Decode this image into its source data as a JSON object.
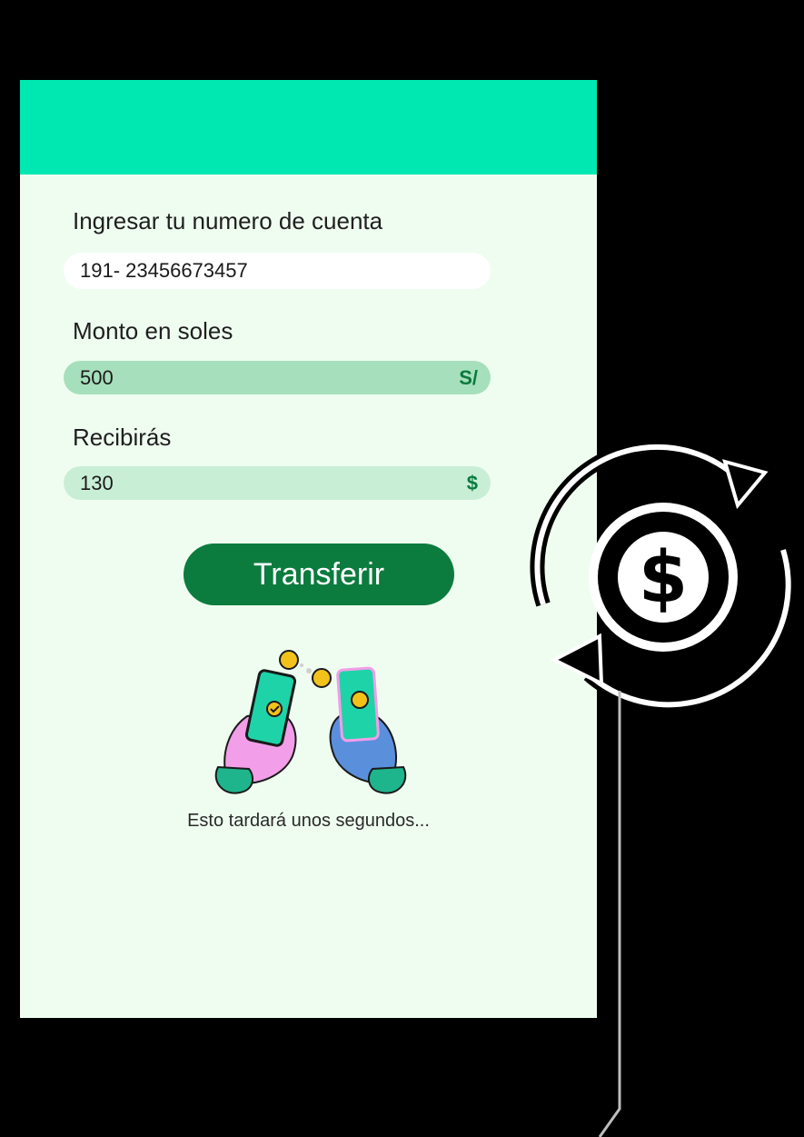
{
  "form": {
    "account_label": "Ingresar tu numero de cuenta",
    "account_value": "191- 23456673457",
    "amount_label": "Monto en soles",
    "amount_value": "500",
    "amount_currency": "S/",
    "receive_label": "Recibirás",
    "receive_value": "130",
    "receive_currency": "$"
  },
  "actions": {
    "transfer_label": "Transferir"
  },
  "status": {
    "hint": "Esto tardará unos segundos..."
  },
  "icons": {
    "illustration": "phones-exchange-coins-illustration",
    "exchange": "currency-exchange-icon"
  },
  "colors": {
    "header": "#00e8b1",
    "background": "#effdf0",
    "primary": "#0c7b3e",
    "amount_field": "#a6dfbb",
    "receive_field": "#c9eed6"
  }
}
